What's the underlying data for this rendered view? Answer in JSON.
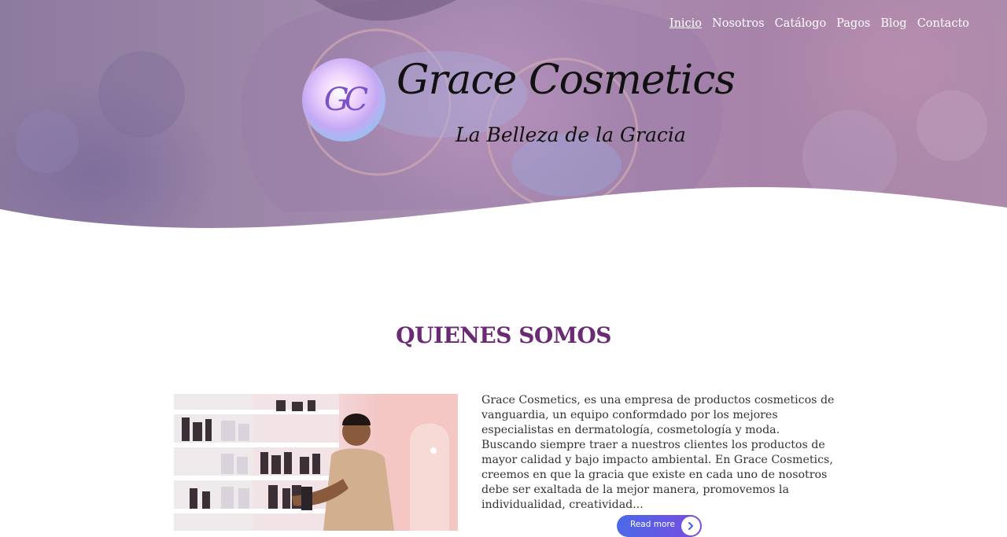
{
  "nav": {
    "items": [
      {
        "label": "Inicio",
        "active": true
      },
      {
        "label": "Nosotros"
      },
      {
        "label": "Catálogo"
      },
      {
        "label": "Pagos"
      },
      {
        "label": "Blog"
      },
      {
        "label": "Contacto"
      }
    ]
  },
  "hero": {
    "logo_mark": "GC",
    "brand": "Grace Cosmetics",
    "tagline": "La Belleza de la Gracia"
  },
  "about": {
    "title": "QUIENES SOMOS",
    "text": "Grace Cosmetics, es una empresa de productos cosmeticos de vanguardia, un equipo conformdado por los mejores especialistas en dermatología, cosmetología y moda. Buscando siempre traer a nuestros clientes los productos de mayor calidad y bajo impacto ambiental. En Grace Cosmetics, creemos en que la gracia que existe en cada uno de nosotros debe ser exaltada de la mejor manera, promovemos la individualidad, creatividad...",
    "read_more": "Read more",
    "read_more_icon": "chevron-right-icon"
  },
  "colors": {
    "accent_title": "#6b2a74",
    "button_start": "#4a6ae8",
    "button_end": "#7a4be0"
  }
}
